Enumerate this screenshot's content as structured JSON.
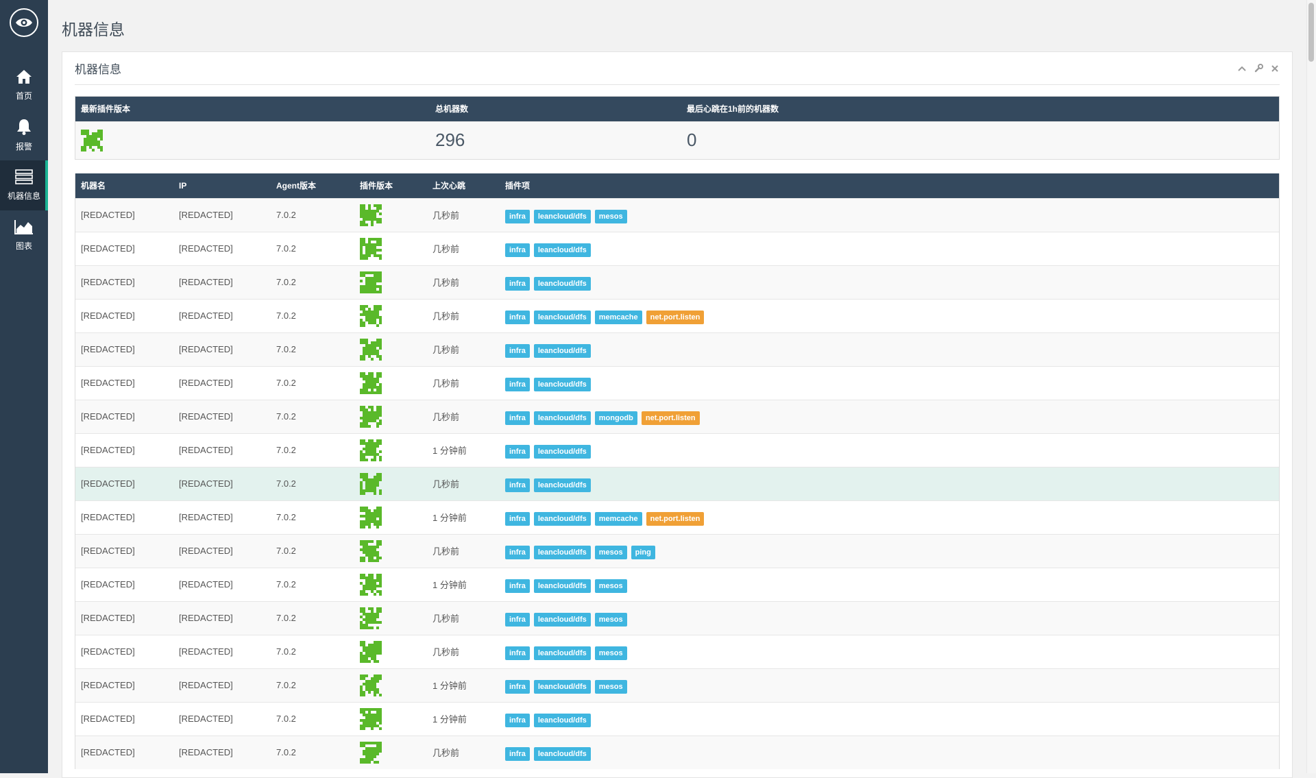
{
  "nav": {
    "items": [
      {
        "label": "首页",
        "icon": "home-icon"
      },
      {
        "label": "报警",
        "icon": "bell-icon"
      },
      {
        "label": "机器信息",
        "icon": "server-icon"
      },
      {
        "label": "图表",
        "icon": "area-chart-icon"
      }
    ],
    "active": 2
  },
  "page": {
    "title": "机器信息"
  },
  "panel": {
    "title": "机器信息"
  },
  "summary": {
    "headers": [
      "最新插件版本",
      "总机器数",
      "最后心跳在1h前的机器数"
    ],
    "total_machines": "296",
    "stale_machines": "0"
  },
  "machines": {
    "headers": [
      "机器名",
      "IP",
      "Agent版本",
      "插件版本",
      "上次心跳",
      "插件项"
    ],
    "rows": [
      {
        "name": "[REDACTED]",
        "ip": "[REDACTED]",
        "agent": "7.0.2",
        "heartbeat": "几秒前",
        "plugins": [
          {
            "t": "infra",
            "k": "info"
          },
          {
            "t": "leancloud/dfs",
            "k": "info"
          },
          {
            "t": "mesos",
            "k": "info"
          }
        ]
      },
      {
        "name": "[REDACTED]",
        "ip": "[REDACTED]",
        "agent": "7.0.2",
        "heartbeat": "几秒前",
        "plugins": [
          {
            "t": "infra",
            "k": "info"
          },
          {
            "t": "leancloud/dfs",
            "k": "info"
          }
        ]
      },
      {
        "name": "[REDACTED]",
        "ip": "[REDACTED]",
        "agent": "7.0.2",
        "heartbeat": "几秒前",
        "plugins": [
          {
            "t": "infra",
            "k": "info"
          },
          {
            "t": "leancloud/dfs",
            "k": "info"
          }
        ]
      },
      {
        "name": "[REDACTED]",
        "ip": "[REDACTED]",
        "agent": "7.0.2",
        "heartbeat": "几秒前",
        "plugins": [
          {
            "t": "infra",
            "k": "info"
          },
          {
            "t": "leancloud/dfs",
            "k": "info"
          },
          {
            "t": "memcache",
            "k": "info"
          },
          {
            "t": "net.port.listen",
            "k": "warn"
          }
        ]
      },
      {
        "name": "[REDACTED]",
        "ip": "[REDACTED]",
        "agent": "7.0.2",
        "heartbeat": "几秒前",
        "plugins": [
          {
            "t": "infra",
            "k": "info"
          },
          {
            "t": "leancloud/dfs",
            "k": "info"
          }
        ]
      },
      {
        "name": "[REDACTED]",
        "ip": "[REDACTED]",
        "agent": "7.0.2",
        "heartbeat": "几秒前",
        "plugins": [
          {
            "t": "infra",
            "k": "info"
          },
          {
            "t": "leancloud/dfs",
            "k": "info"
          }
        ]
      },
      {
        "name": "[REDACTED]",
        "ip": "[REDACTED]",
        "agent": "7.0.2",
        "heartbeat": "几秒前",
        "plugins": [
          {
            "t": "infra",
            "k": "info"
          },
          {
            "t": "leancloud/dfs",
            "k": "info"
          },
          {
            "t": "mongodb",
            "k": "info"
          },
          {
            "t": "net.port.listen",
            "k": "warn"
          }
        ]
      },
      {
        "name": "[REDACTED]",
        "ip": "[REDACTED]",
        "agent": "7.0.2",
        "heartbeat": "1 分钟前",
        "plugins": [
          {
            "t": "infra",
            "k": "info"
          },
          {
            "t": "leancloud/dfs",
            "k": "info"
          }
        ]
      },
      {
        "name": "[REDACTED]",
        "ip": "[REDACTED]",
        "agent": "7.0.2",
        "heartbeat": "几秒前",
        "highlight": true,
        "plugins": [
          {
            "t": "infra",
            "k": "info"
          },
          {
            "t": "leancloud/dfs",
            "k": "info"
          }
        ]
      },
      {
        "name": "[REDACTED]",
        "ip": "[REDACTED]",
        "agent": "7.0.2",
        "heartbeat": "1 分钟前",
        "plugins": [
          {
            "t": "infra",
            "k": "info"
          },
          {
            "t": "leancloud/dfs",
            "k": "info"
          },
          {
            "t": "memcache",
            "k": "info"
          },
          {
            "t": "net.port.listen",
            "k": "warn"
          }
        ]
      },
      {
        "name": "[REDACTED]",
        "ip": "[REDACTED]",
        "agent": "7.0.2",
        "heartbeat": "几秒前",
        "plugins": [
          {
            "t": "infra",
            "k": "info"
          },
          {
            "t": "leancloud/dfs",
            "k": "info"
          },
          {
            "t": "mesos",
            "k": "info"
          },
          {
            "t": "ping",
            "k": "info"
          }
        ]
      },
      {
        "name": "[REDACTED]",
        "ip": "[REDACTED]",
        "agent": "7.0.2",
        "heartbeat": "1 分钟前",
        "plugins": [
          {
            "t": "infra",
            "k": "info"
          },
          {
            "t": "leancloud/dfs",
            "k": "info"
          },
          {
            "t": "mesos",
            "k": "info"
          }
        ]
      },
      {
        "name": "[REDACTED]",
        "ip": "[REDACTED]",
        "agent": "7.0.2",
        "heartbeat": "几秒前",
        "plugins": [
          {
            "t": "infra",
            "k": "info"
          },
          {
            "t": "leancloud/dfs",
            "k": "info"
          },
          {
            "t": "mesos",
            "k": "info"
          }
        ]
      },
      {
        "name": "[REDACTED]",
        "ip": "[REDACTED]",
        "agent": "7.0.2",
        "heartbeat": "几秒前",
        "plugins": [
          {
            "t": "infra",
            "k": "info"
          },
          {
            "t": "leancloud/dfs",
            "k": "info"
          },
          {
            "t": "mesos",
            "k": "info"
          }
        ]
      },
      {
        "name": "[REDACTED]",
        "ip": "[REDACTED]",
        "agent": "7.0.2",
        "heartbeat": "1 分钟前",
        "plugins": [
          {
            "t": "infra",
            "k": "info"
          },
          {
            "t": "leancloud/dfs",
            "k": "info"
          },
          {
            "t": "mesos",
            "k": "info"
          }
        ]
      },
      {
        "name": "[REDACTED]",
        "ip": "[REDACTED]",
        "agent": "7.0.2",
        "heartbeat": "1 分钟前",
        "plugins": [
          {
            "t": "infra",
            "k": "info"
          },
          {
            "t": "leancloud/dfs",
            "k": "info"
          }
        ]
      },
      {
        "name": "[REDACTED]",
        "ip": "[REDACTED]",
        "agent": "7.0.2",
        "heartbeat": "几秒前",
        "plugins": [
          {
            "t": "infra",
            "k": "info"
          },
          {
            "t": "leancloud/dfs",
            "k": "info"
          }
        ]
      }
    ]
  },
  "colors": {
    "sidebar": "#2c3e50",
    "table_header": "#34495e",
    "tag_info": "#3fb6e0",
    "tag_warn": "#f0a036",
    "qr_green": "#5ab92a",
    "active_accent": "#1ab394"
  }
}
